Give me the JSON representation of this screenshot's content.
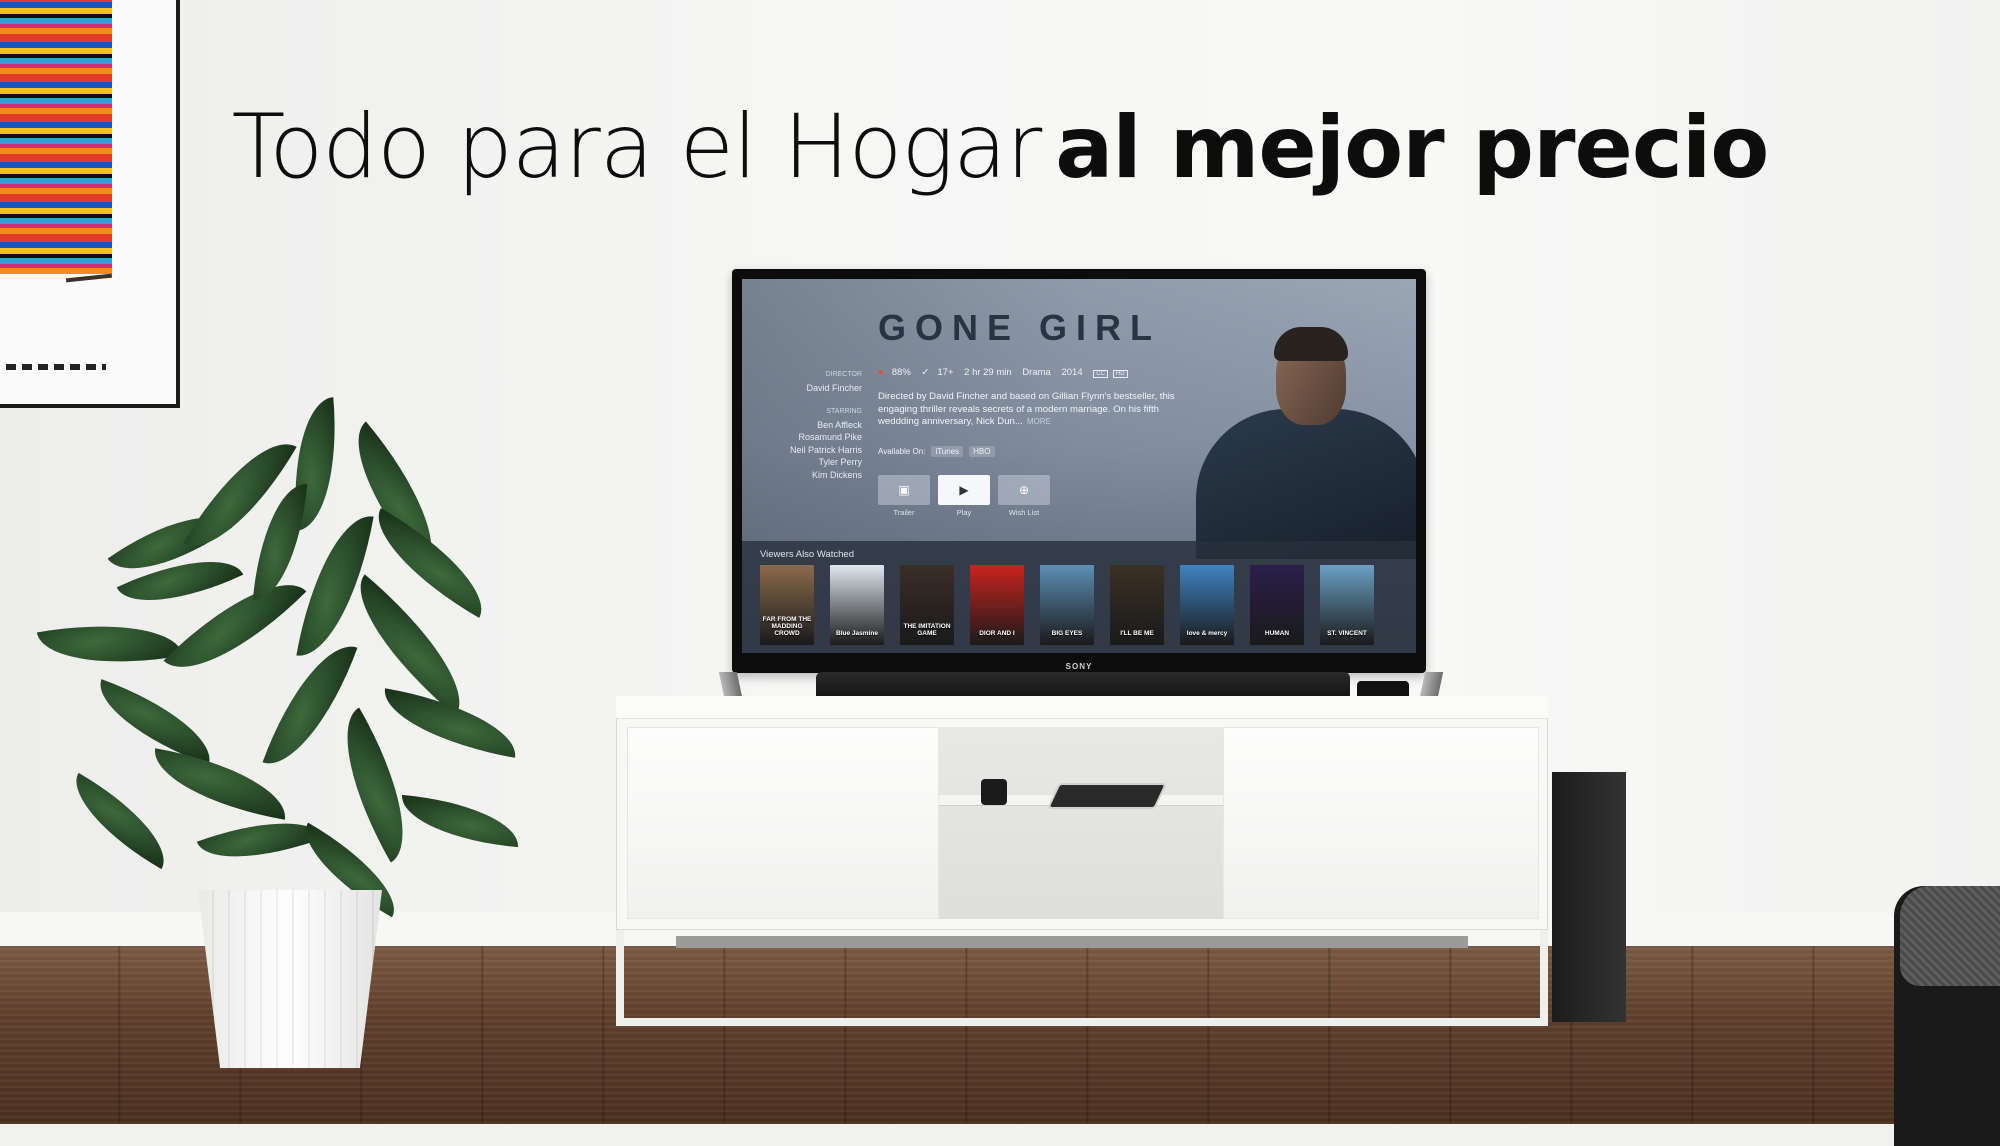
{
  "headline": {
    "light_text": "Todo para el Hogar",
    "bold_text": "al mejor precio"
  },
  "tv": {
    "brand": "SONY",
    "app": {
      "movie_title": "GONE GIRL",
      "director_label": "DIRECTOR",
      "director": "David Fincher",
      "starring_label": "STARRING",
      "cast": [
        "Ben Affleck",
        "Rosamund Pike",
        "Neil Patrick Harris",
        "Tyler Perry",
        "Kim Dickens"
      ],
      "rating_score": "88%",
      "audience_score": "17+",
      "runtime": "2 hr 29 min",
      "genre": "Drama",
      "year": "2014",
      "badge_cc": "CC",
      "badge_hd": "HD",
      "description": "Directed by David Fincher and based on Gillian Flynn's bestseller, this engaging thriller reveals secrets of a modern marriage. On his fifth weddding anniversary, Nick Dun...",
      "more_label": "MORE",
      "available_label": "Available On:",
      "providers": [
        "iTunes",
        "HBO"
      ],
      "buttons": [
        {
          "label": "Trailer",
          "icon": "tv-icon"
        },
        {
          "label": "Play",
          "icon": "play-icon"
        },
        {
          "label": "Wish List",
          "icon": "plus-icon"
        }
      ],
      "also_watched_label": "Viewers Also Watched",
      "posters": [
        {
          "title": "FAR FROM THE MADDING CROWD",
          "color": "#8a6b4a"
        },
        {
          "title": "Blue Jasmine",
          "color": "#dfe7ef"
        },
        {
          "title": "THE IMITATION GAME",
          "color": "#3a2e28"
        },
        {
          "title": "DIOR AND I",
          "color": "#c9231f"
        },
        {
          "title": "BIG EYES",
          "color": "#5c8fb5"
        },
        {
          "title": "I'LL BE ME",
          "color": "#3b3024"
        },
        {
          "title": "love & mercy",
          "color": "#3f83c2"
        },
        {
          "title": "HUMAN",
          "color": "#2a1f4a"
        },
        {
          "title": "ST. VINCENT",
          "color": "#6aa1c4"
        }
      ]
    }
  }
}
